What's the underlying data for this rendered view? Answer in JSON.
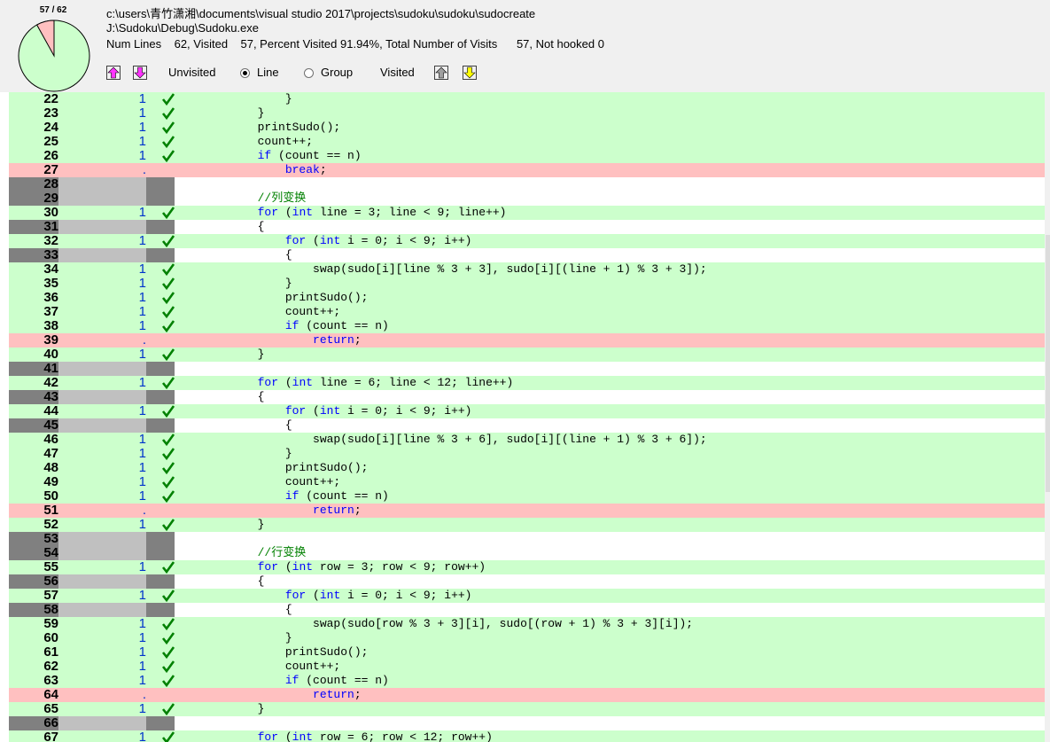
{
  "header": {
    "pie_label": "57 / 62",
    "visited_fraction": 0.9194,
    "colors": {
      "visited": "#ccffcc",
      "unvisited": "#ffc0c0"
    },
    "source_path": "c:\\users\\青竹潇湘\\documents\\visual studio 2017\\projects\\sudoku\\sudoku\\sudocreate",
    "exe_path": "J:\\Sudoku\\Debug\\Sudoku.exe",
    "stats": "Num Lines    62, Visited    57, Percent Visited 91.94%, Total Number of Visits      57, Not hooked 0",
    "legend": {
      "unvisited_label": "Unvisited",
      "line_label": "Line",
      "group_label": "Group",
      "visited_label": "Visited",
      "selected_mode": "Line"
    },
    "icons": {
      "prev_unvisited": "arrow-up-magenta-icon",
      "next_unvisited": "arrow-down-magenta-icon",
      "prev_visited": "arrow-up-gray-icon",
      "next_visited": "arrow-down-yellow-icon"
    }
  },
  "code_rows": [
    {
      "ln": "22",
      "status": "visited",
      "count": "1",
      "code": "                }"
    },
    {
      "ln": "23",
      "status": "visited",
      "count": "1",
      "code": "            }"
    },
    {
      "ln": "24",
      "status": "visited",
      "count": "1",
      "code": "            printSudo();"
    },
    {
      "ln": "25",
      "status": "visited",
      "count": "1",
      "code": "            count++;"
    },
    {
      "ln": "26",
      "status": "visited",
      "count": "1",
      "code": "            if (count == n)"
    },
    {
      "ln": "27",
      "status": "unvisited",
      "count": ".",
      "code": "                break;"
    },
    {
      "ln": "28",
      "status": "blank",
      "count": "",
      "code": ""
    },
    {
      "ln": "29",
      "status": "blank",
      "count": "",
      "code": "            //列变换"
    },
    {
      "ln": "30",
      "status": "visited",
      "count": "1",
      "code": "            for (int line = 3; line < 9; line++)"
    },
    {
      "ln": "31",
      "status": "blank",
      "count": "",
      "code": "            {"
    },
    {
      "ln": "32",
      "status": "visited",
      "count": "1",
      "code": "                for (int i = 0; i < 9; i++)"
    },
    {
      "ln": "33",
      "status": "blank",
      "count": "",
      "code": "                {"
    },
    {
      "ln": "34",
      "status": "visited",
      "count": "1",
      "code": "                    swap(sudo[i][line % 3 + 3], sudo[i][(line + 1) % 3 + 3]);"
    },
    {
      "ln": "35",
      "status": "visited",
      "count": "1",
      "code": "                }"
    },
    {
      "ln": "36",
      "status": "visited",
      "count": "1",
      "code": "                printSudo();"
    },
    {
      "ln": "37",
      "status": "visited",
      "count": "1",
      "code": "                count++;"
    },
    {
      "ln": "38",
      "status": "visited",
      "count": "1",
      "code": "                if (count == n)"
    },
    {
      "ln": "39",
      "status": "unvisited",
      "count": ".",
      "code": "                    return;"
    },
    {
      "ln": "40",
      "status": "visited",
      "count": "1",
      "code": "            }"
    },
    {
      "ln": "41",
      "status": "blank",
      "count": "",
      "code": ""
    },
    {
      "ln": "42",
      "status": "visited",
      "count": "1",
      "code": "            for (int line = 6; line < 12; line++)"
    },
    {
      "ln": "43",
      "status": "blank",
      "count": "",
      "code": "            {"
    },
    {
      "ln": "44",
      "status": "visited",
      "count": "1",
      "code": "                for (int i = 0; i < 9; i++)"
    },
    {
      "ln": "45",
      "status": "blank",
      "count": "",
      "code": "                {"
    },
    {
      "ln": "46",
      "status": "visited",
      "count": "1",
      "code": "                    swap(sudo[i][line % 3 + 6], sudo[i][(line + 1) % 3 + 6]);"
    },
    {
      "ln": "47",
      "status": "visited",
      "count": "1",
      "code": "                }"
    },
    {
      "ln": "48",
      "status": "visited",
      "count": "1",
      "code": "                printSudo();"
    },
    {
      "ln": "49",
      "status": "visited",
      "count": "1",
      "code": "                count++;"
    },
    {
      "ln": "50",
      "status": "visited",
      "count": "1",
      "code": "                if (count == n)"
    },
    {
      "ln": "51",
      "status": "unvisited",
      "count": ".",
      "code": "                    return;"
    },
    {
      "ln": "52",
      "status": "visited",
      "count": "1",
      "code": "            }"
    },
    {
      "ln": "53",
      "status": "blank",
      "count": "",
      "code": ""
    },
    {
      "ln": "54",
      "status": "blank",
      "count": "",
      "code": "            //行变换"
    },
    {
      "ln": "55",
      "status": "visited",
      "count": "1",
      "code": "            for (int row = 3; row < 9; row++)"
    },
    {
      "ln": "56",
      "status": "blank",
      "count": "",
      "code": "            {"
    },
    {
      "ln": "57",
      "status": "visited",
      "count": "1",
      "code": "                for (int i = 0; i < 9; i++)"
    },
    {
      "ln": "58",
      "status": "blank",
      "count": "",
      "code": "                {"
    },
    {
      "ln": "59",
      "status": "visited",
      "count": "1",
      "code": "                    swap(sudo[row % 3 + 3][i], sudo[(row + 1) % 3 + 3][i]);"
    },
    {
      "ln": "60",
      "status": "visited",
      "count": "1",
      "code": "                }"
    },
    {
      "ln": "61",
      "status": "visited",
      "count": "1",
      "code": "                printSudo();"
    },
    {
      "ln": "62",
      "status": "visited",
      "count": "1",
      "code": "                count++;"
    },
    {
      "ln": "63",
      "status": "visited",
      "count": "1",
      "code": "                if (count == n)"
    },
    {
      "ln": "64",
      "status": "unvisited",
      "count": ".",
      "code": "                    return;"
    },
    {
      "ln": "65",
      "status": "visited",
      "count": "1",
      "code": "            }"
    },
    {
      "ln": "66",
      "status": "blank",
      "count": "",
      "code": ""
    },
    {
      "ln": "67",
      "status": "visited",
      "count": "1",
      "code": "            for (int row = 6; row < 12; row++)"
    }
  ]
}
